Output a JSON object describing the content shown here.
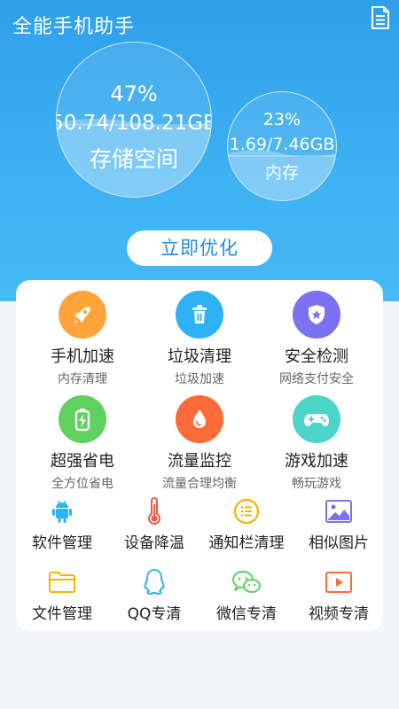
{
  "app_title": "全能手机助手",
  "storage": {
    "percent": "47%",
    "usage": "50.74/108.21GB",
    "label": "存储空间",
    "level": 0.47
  },
  "memory": {
    "percent": "23%",
    "usage": "1.69/7.46GB",
    "label": "内存",
    "level": 0.42
  },
  "optimize_button": "立即优化",
  "colors": {
    "header_top": "#2f9fea",
    "header_bottom": "#46baf6",
    "orange": "#ffa43a",
    "blue": "#2eb2f5",
    "purple": "#7c72f1",
    "green": "#5fd15f",
    "red": "#ff6a3b",
    "teal": "#4ad5c8"
  },
  "features": [
    {
      "name": "手机加速",
      "sub": "内存清理",
      "icon": "rocket-icon"
    },
    {
      "name": "垃圾清理",
      "sub": "垃圾加速",
      "icon": "trash-icon"
    },
    {
      "name": "安全检测",
      "sub": "网络支付安全",
      "icon": "shield-icon"
    },
    {
      "name": "超强省电",
      "sub": "全方位省电",
      "icon": "battery-icon"
    },
    {
      "name": "流量监控",
      "sub": "流量合理均衡",
      "icon": "drop-icon"
    },
    {
      "name": "游戏加速",
      "sub": "畅玩游戏",
      "icon": "gamepad-icon"
    }
  ],
  "tools": [
    {
      "name": "软件管理",
      "icon": "android-icon"
    },
    {
      "name": "设备降温",
      "icon": "thermometer-icon"
    },
    {
      "name": "通知栏清理",
      "icon": "list-icon"
    },
    {
      "name": "相似图片",
      "icon": "image-icon"
    },
    {
      "name": "文件管理",
      "icon": "folder-icon"
    },
    {
      "name": "QQ专清",
      "icon": "qq-icon"
    },
    {
      "name": "微信专清",
      "icon": "wechat-icon"
    },
    {
      "name": "视频专清",
      "icon": "video-icon"
    }
  ]
}
